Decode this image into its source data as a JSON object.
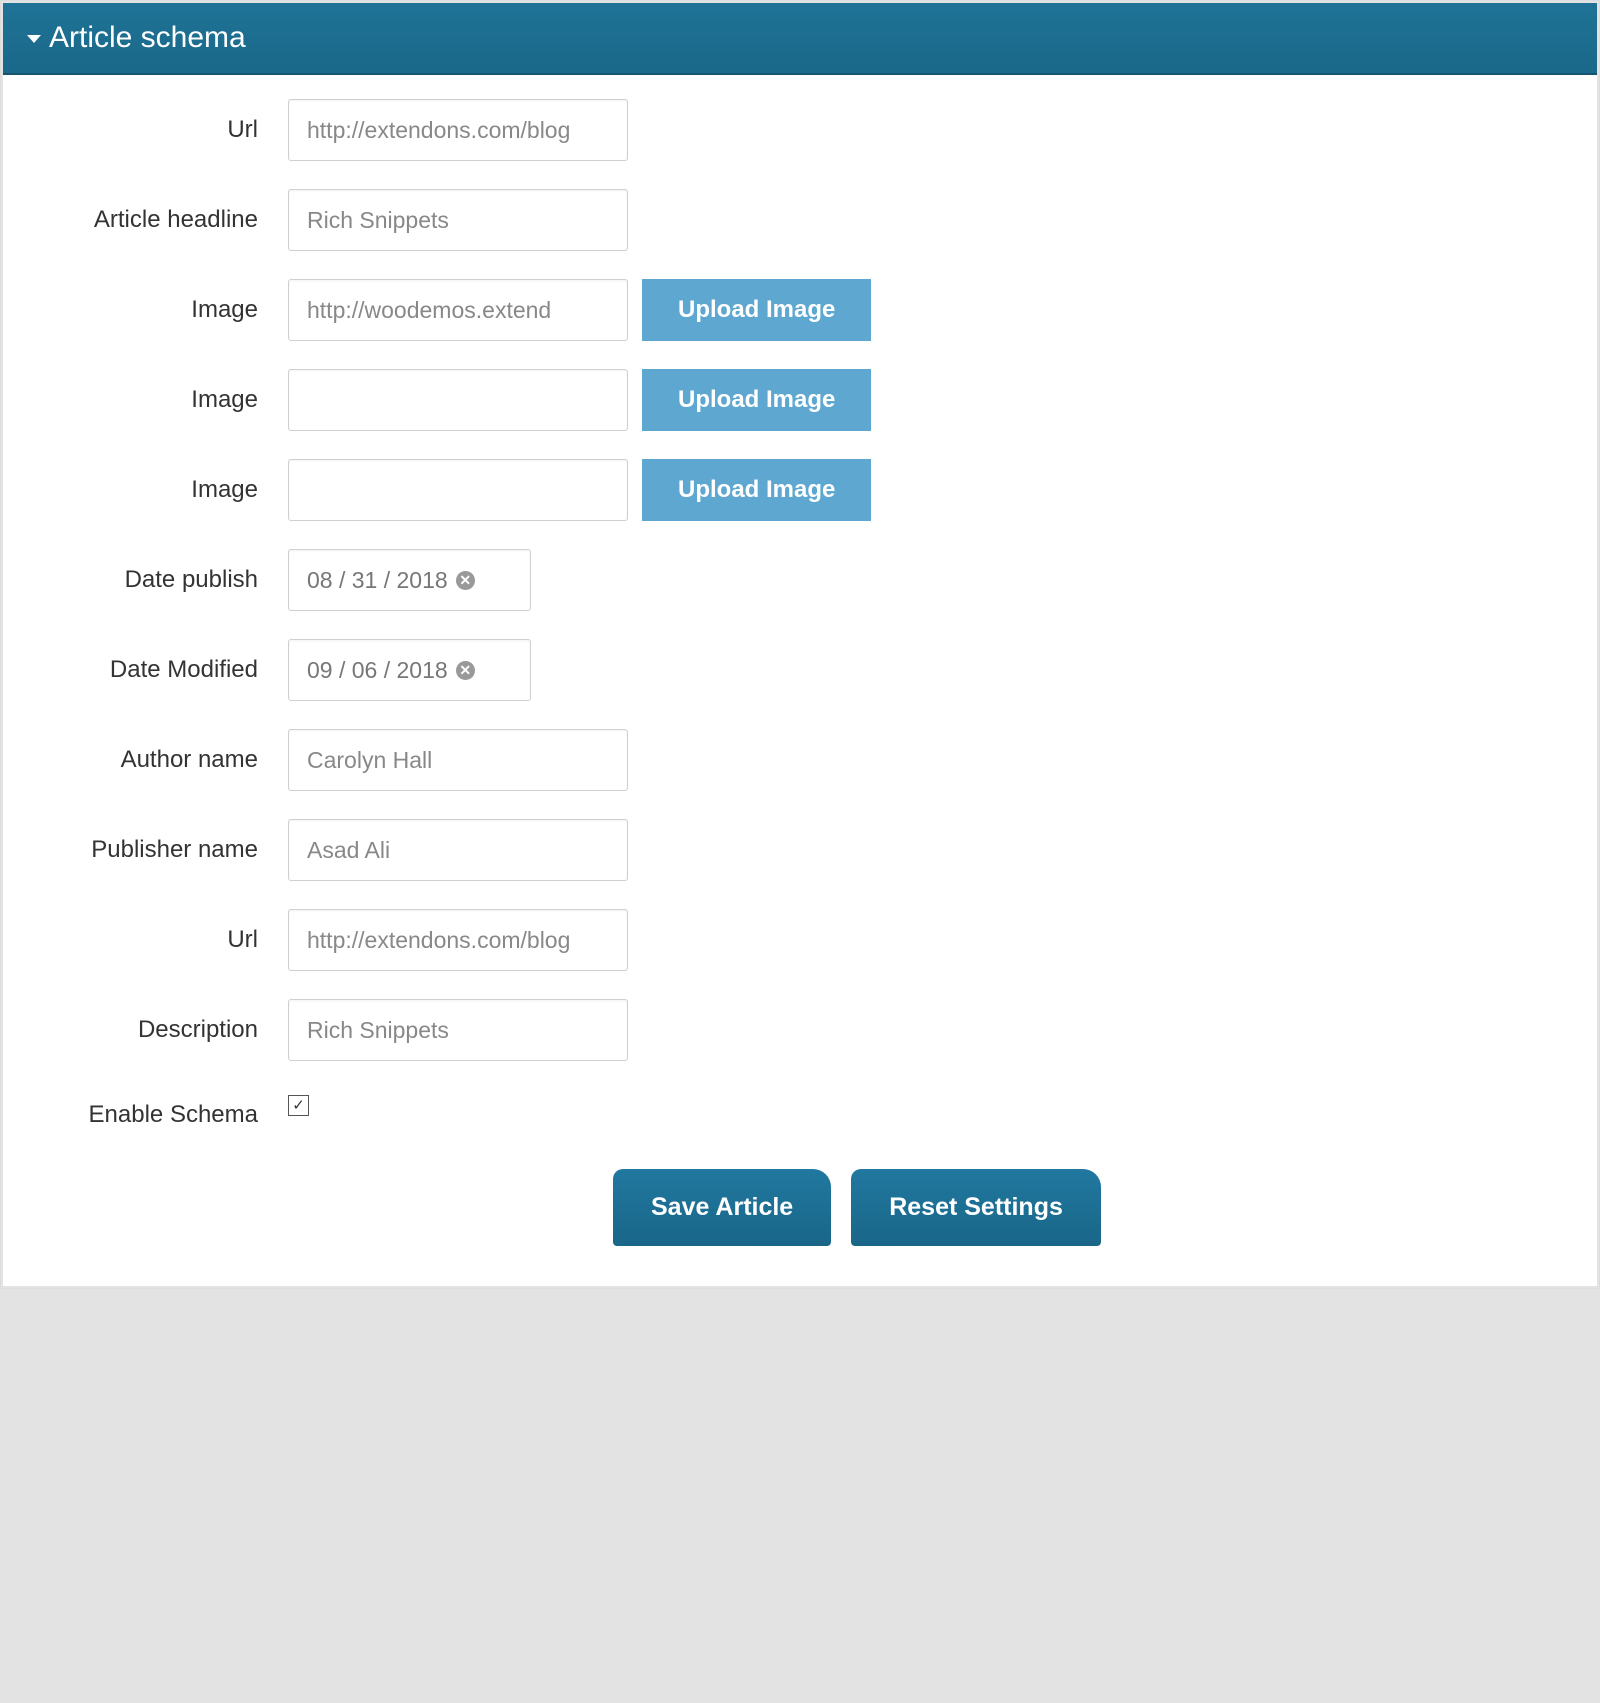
{
  "panel": {
    "title": "Article schema"
  },
  "form": {
    "url": {
      "label": "Url",
      "value": "http://extendons.com/blog"
    },
    "headline": {
      "label": "Article headline",
      "value": "Rich Snippets"
    },
    "image1": {
      "label": "Image",
      "value": "http://woodemos.extend",
      "button": "Upload Image"
    },
    "image2": {
      "label": "Image",
      "value": "",
      "button": "Upload Image"
    },
    "image3": {
      "label": "Image",
      "value": "",
      "button": "Upload Image"
    },
    "datePublish": {
      "label": "Date publish",
      "value": "08 / 31 / 2018"
    },
    "dateModified": {
      "label": "Date Modified",
      "value": "09 / 06 / 2018"
    },
    "authorName": {
      "label": "Author name",
      "value": "Carolyn Hall"
    },
    "publisherName": {
      "label": "Publisher name",
      "value": "Asad Ali"
    },
    "url2": {
      "label": "Url",
      "value": "http://extendons.com/blog"
    },
    "description": {
      "label": "Description",
      "value": "Rich Snippets"
    },
    "enableSchema": {
      "label": "Enable Schema",
      "checked": true
    }
  },
  "buttons": {
    "save": "Save Article",
    "reset": "Reset Settings"
  }
}
